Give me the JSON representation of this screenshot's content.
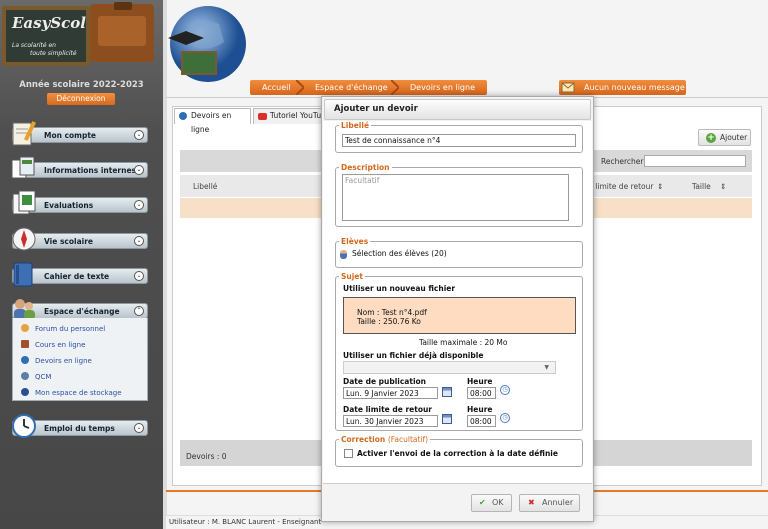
{
  "sidebar": {
    "logo_title": "EasyScol",
    "logo_tagline_1": "La scolarité en",
    "logo_tagline_2": "toute simplicité",
    "school_year": "Année scolaire 2022-2023",
    "logout_label": "Déconnexion",
    "menus": [
      {
        "label": "Mon compte",
        "icon": "notepad-pencil-icon"
      },
      {
        "label": "Informations internes",
        "icon": "documents-icon"
      },
      {
        "label": "Evaluations",
        "icon": "sheets-icon"
      },
      {
        "label": "Vie scolaire",
        "icon": "compass-icon"
      },
      {
        "label": "Cahier de texte",
        "icon": "book-icon"
      },
      {
        "label": "Espace d'échange",
        "icon": "people-exchange-icon"
      },
      {
        "label": "Emploi du temps",
        "icon": "clock-icon"
      }
    ],
    "sub_items": [
      {
        "label": "Forum du personnel",
        "icon": "forum-icon"
      },
      {
        "label": "Cours en ligne",
        "icon": "course-icon"
      },
      {
        "label": "Devoirs en ligne",
        "icon": "globe-icon"
      },
      {
        "label": "QCM",
        "icon": "qcm-icon"
      },
      {
        "label": "Mon espace de stockage",
        "icon": "storage-icon"
      }
    ]
  },
  "header": {
    "breadcrumb": [
      "Accueil",
      "Espace d'échange",
      "Devoirs en ligne"
    ],
    "message_label": "Aucun nouveau message",
    "accent": "#e27a2a"
  },
  "main": {
    "tabs": [
      "Devoirs en ligne",
      "Tutoriel YouTube"
    ],
    "add_button": "Ajouter",
    "search_label": "Rechercher :",
    "search_value": "",
    "columns": [
      "Libellé",
      "Date limite de retour",
      "Taille"
    ],
    "footer_count": "Devoirs : 0"
  },
  "status": "Utilisateur : M. BLANC Laurent - Enseignant",
  "modal": {
    "title": "Ajouter un devoir",
    "libelle_legend": "Libellé",
    "libelle_value": "Test de connaissance n°4",
    "description_legend": "Description",
    "description_placeholder": "Facultatif",
    "eleves_legend": "Elèves",
    "eleves_selection": "Sélection des élèves (20)",
    "sujet_legend": "Sujet",
    "new_file_label": "Utiliser un nouveau fichier",
    "file_name": "Nom : Test n°4.pdf",
    "file_size": "Taille : 250.76 Ko",
    "max_size": "Taille maximale : 20 Mo",
    "existing_file_label": "Utiliser un fichier déjà disponible",
    "existing_file_value": "",
    "pub_date_label": "Date de publication",
    "pub_date_value": "Lun. 9 Janvier 2023",
    "pub_hour_label": "Heure",
    "pub_hour_value": "08:00",
    "due_date_label": "Date limite de retour",
    "due_date_value": "Lun. 30 Janvier 2023",
    "due_hour_label": "Heure",
    "due_hour_value": "08:00",
    "correction_legend": "Correction",
    "correction_optional": "(Facultatif)",
    "correction_checkbox": "Activer l'envoi de la correction à la date définie",
    "ok_label": "OK",
    "cancel_label": "Annuler"
  }
}
